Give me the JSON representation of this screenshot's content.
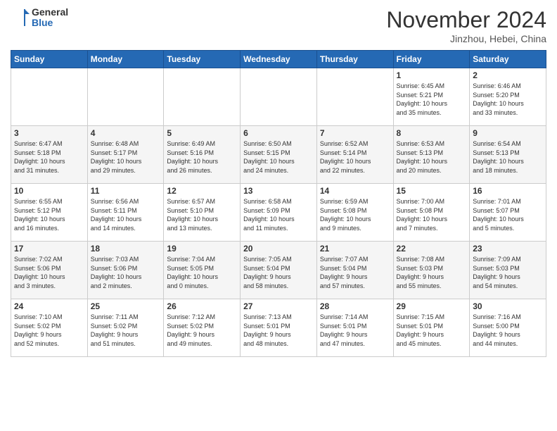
{
  "header": {
    "logo_general": "General",
    "logo_blue": "Blue",
    "month_title": "November 2024",
    "location": "Jinzhou, Hebei, China"
  },
  "weekdays": [
    "Sunday",
    "Monday",
    "Tuesday",
    "Wednesday",
    "Thursday",
    "Friday",
    "Saturday"
  ],
  "weeks": [
    [
      {
        "day": "",
        "info": ""
      },
      {
        "day": "",
        "info": ""
      },
      {
        "day": "",
        "info": ""
      },
      {
        "day": "",
        "info": ""
      },
      {
        "day": "",
        "info": ""
      },
      {
        "day": "1",
        "info": "Sunrise: 6:45 AM\nSunset: 5:21 PM\nDaylight: 10 hours\nand 35 minutes."
      },
      {
        "day": "2",
        "info": "Sunrise: 6:46 AM\nSunset: 5:20 PM\nDaylight: 10 hours\nand 33 minutes."
      }
    ],
    [
      {
        "day": "3",
        "info": "Sunrise: 6:47 AM\nSunset: 5:18 PM\nDaylight: 10 hours\nand 31 minutes."
      },
      {
        "day": "4",
        "info": "Sunrise: 6:48 AM\nSunset: 5:17 PM\nDaylight: 10 hours\nand 29 minutes."
      },
      {
        "day": "5",
        "info": "Sunrise: 6:49 AM\nSunset: 5:16 PM\nDaylight: 10 hours\nand 26 minutes."
      },
      {
        "day": "6",
        "info": "Sunrise: 6:50 AM\nSunset: 5:15 PM\nDaylight: 10 hours\nand 24 minutes."
      },
      {
        "day": "7",
        "info": "Sunrise: 6:52 AM\nSunset: 5:14 PM\nDaylight: 10 hours\nand 22 minutes."
      },
      {
        "day": "8",
        "info": "Sunrise: 6:53 AM\nSunset: 5:13 PM\nDaylight: 10 hours\nand 20 minutes."
      },
      {
        "day": "9",
        "info": "Sunrise: 6:54 AM\nSunset: 5:13 PM\nDaylight: 10 hours\nand 18 minutes."
      }
    ],
    [
      {
        "day": "10",
        "info": "Sunrise: 6:55 AM\nSunset: 5:12 PM\nDaylight: 10 hours\nand 16 minutes."
      },
      {
        "day": "11",
        "info": "Sunrise: 6:56 AM\nSunset: 5:11 PM\nDaylight: 10 hours\nand 14 minutes."
      },
      {
        "day": "12",
        "info": "Sunrise: 6:57 AM\nSunset: 5:10 PM\nDaylight: 10 hours\nand 13 minutes."
      },
      {
        "day": "13",
        "info": "Sunrise: 6:58 AM\nSunset: 5:09 PM\nDaylight: 10 hours\nand 11 minutes."
      },
      {
        "day": "14",
        "info": "Sunrise: 6:59 AM\nSunset: 5:08 PM\nDaylight: 10 hours\nand 9 minutes."
      },
      {
        "day": "15",
        "info": "Sunrise: 7:00 AM\nSunset: 5:08 PM\nDaylight: 10 hours\nand 7 minutes."
      },
      {
        "day": "16",
        "info": "Sunrise: 7:01 AM\nSunset: 5:07 PM\nDaylight: 10 hours\nand 5 minutes."
      }
    ],
    [
      {
        "day": "17",
        "info": "Sunrise: 7:02 AM\nSunset: 5:06 PM\nDaylight: 10 hours\nand 3 minutes."
      },
      {
        "day": "18",
        "info": "Sunrise: 7:03 AM\nSunset: 5:06 PM\nDaylight: 10 hours\nand 2 minutes."
      },
      {
        "day": "19",
        "info": "Sunrise: 7:04 AM\nSunset: 5:05 PM\nDaylight: 10 hours\nand 0 minutes."
      },
      {
        "day": "20",
        "info": "Sunrise: 7:05 AM\nSunset: 5:04 PM\nDaylight: 9 hours\nand 58 minutes."
      },
      {
        "day": "21",
        "info": "Sunrise: 7:07 AM\nSunset: 5:04 PM\nDaylight: 9 hours\nand 57 minutes."
      },
      {
        "day": "22",
        "info": "Sunrise: 7:08 AM\nSunset: 5:03 PM\nDaylight: 9 hours\nand 55 minutes."
      },
      {
        "day": "23",
        "info": "Sunrise: 7:09 AM\nSunset: 5:03 PM\nDaylight: 9 hours\nand 54 minutes."
      }
    ],
    [
      {
        "day": "24",
        "info": "Sunrise: 7:10 AM\nSunset: 5:02 PM\nDaylight: 9 hours\nand 52 minutes."
      },
      {
        "day": "25",
        "info": "Sunrise: 7:11 AM\nSunset: 5:02 PM\nDaylight: 9 hours\nand 51 minutes."
      },
      {
        "day": "26",
        "info": "Sunrise: 7:12 AM\nSunset: 5:02 PM\nDaylight: 9 hours\nand 49 minutes."
      },
      {
        "day": "27",
        "info": "Sunrise: 7:13 AM\nSunset: 5:01 PM\nDaylight: 9 hours\nand 48 minutes."
      },
      {
        "day": "28",
        "info": "Sunrise: 7:14 AM\nSunset: 5:01 PM\nDaylight: 9 hours\nand 47 minutes."
      },
      {
        "day": "29",
        "info": "Sunrise: 7:15 AM\nSunset: 5:01 PM\nDaylight: 9 hours\nand 45 minutes."
      },
      {
        "day": "30",
        "info": "Sunrise: 7:16 AM\nSunset: 5:00 PM\nDaylight: 9 hours\nand 44 minutes."
      }
    ]
  ]
}
